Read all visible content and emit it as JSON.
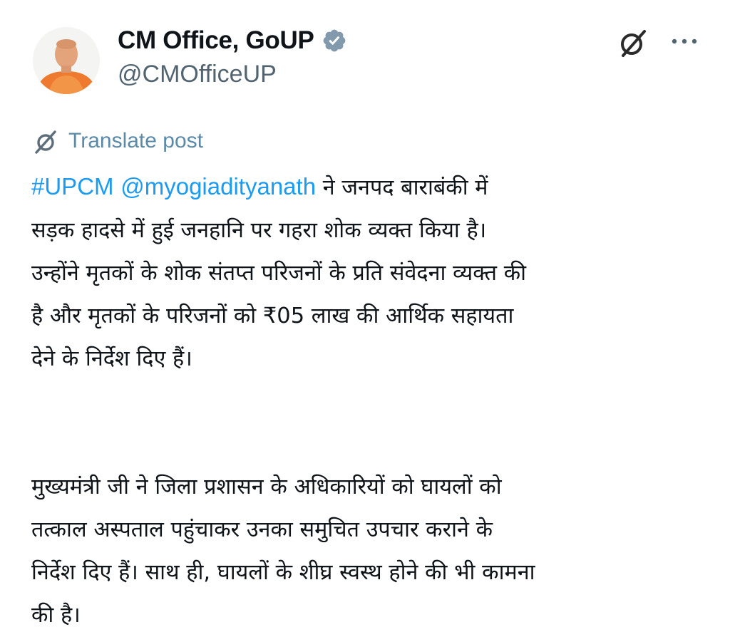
{
  "post": {
    "author": {
      "display_name": "CM Office, GoUP",
      "handle": "@CMOfficeUP",
      "verified_icon": "verified-badge-icon",
      "avatar": "profile-avatar"
    },
    "actions": {
      "grok_icon": "grok-icon",
      "more_icon": "more-options-icon"
    },
    "translate_label": "Translate post",
    "body": {
      "hashtag": "#UPCM",
      "mention": "@myogiadityanath",
      "para1_line1_rest": "ने जनपद बाराबंकी में",
      "para1_line2": "सड़क हादसे में हुई जनहानि पर गहरा शोक व्यक्त किया है।",
      "para1_line3": "उन्होंने मृतकों के शोक संतप्त परिजनों के प्रति संवेदना व्यक्त की",
      "para1_line4": "है और मृतकों के परिजनों को ₹05 लाख की आर्थिक सहायता",
      "para1_line5": "देने के निर्देश दिए हैं।",
      "para2_line1": "मुख्यमंत्री जी ने जिला प्रशासन के अधिकारियों को घायलों को",
      "para2_line2": "तत्काल अस्पताल पहुंचाकर उनका समुचित उपचार कराने के",
      "para2_line3": "निर्देश दिए हैं। साथ ही, घायलों के शीघ्र स्वस्थ होने की भी कामना",
      "para2_line4": "की है।"
    },
    "colors": {
      "link": "#1d9bf0",
      "secondary_text": "#536471",
      "primary_text": "#0f1419",
      "verified_badge": "#829aab"
    }
  }
}
